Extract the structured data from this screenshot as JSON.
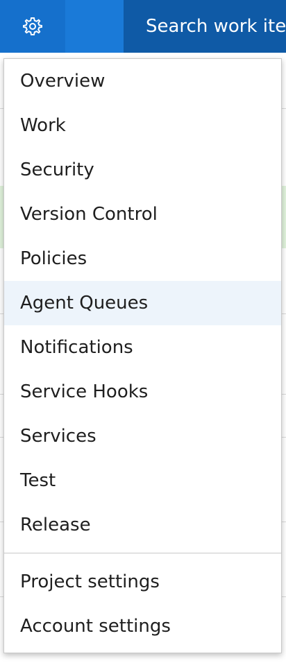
{
  "topbar": {
    "settings_icon": "gear-icon",
    "search_placeholder": "Search work items"
  },
  "menu": {
    "items": [
      {
        "label": "Overview"
      },
      {
        "label": "Work"
      },
      {
        "label": "Security"
      },
      {
        "label": "Version Control"
      },
      {
        "label": "Policies"
      },
      {
        "label": "Agent Queues",
        "highlighted": true
      },
      {
        "label": "Notifications"
      },
      {
        "label": "Service Hooks"
      },
      {
        "label": "Services"
      },
      {
        "label": "Test"
      },
      {
        "label": "Release"
      }
    ],
    "footer_items": [
      {
        "label": "Project settings"
      },
      {
        "label": "Account settings"
      }
    ]
  },
  "colors": {
    "topbar": "#0f64b4",
    "highlight": "#edf4fb",
    "background_banner": "#e1f3dc"
  }
}
